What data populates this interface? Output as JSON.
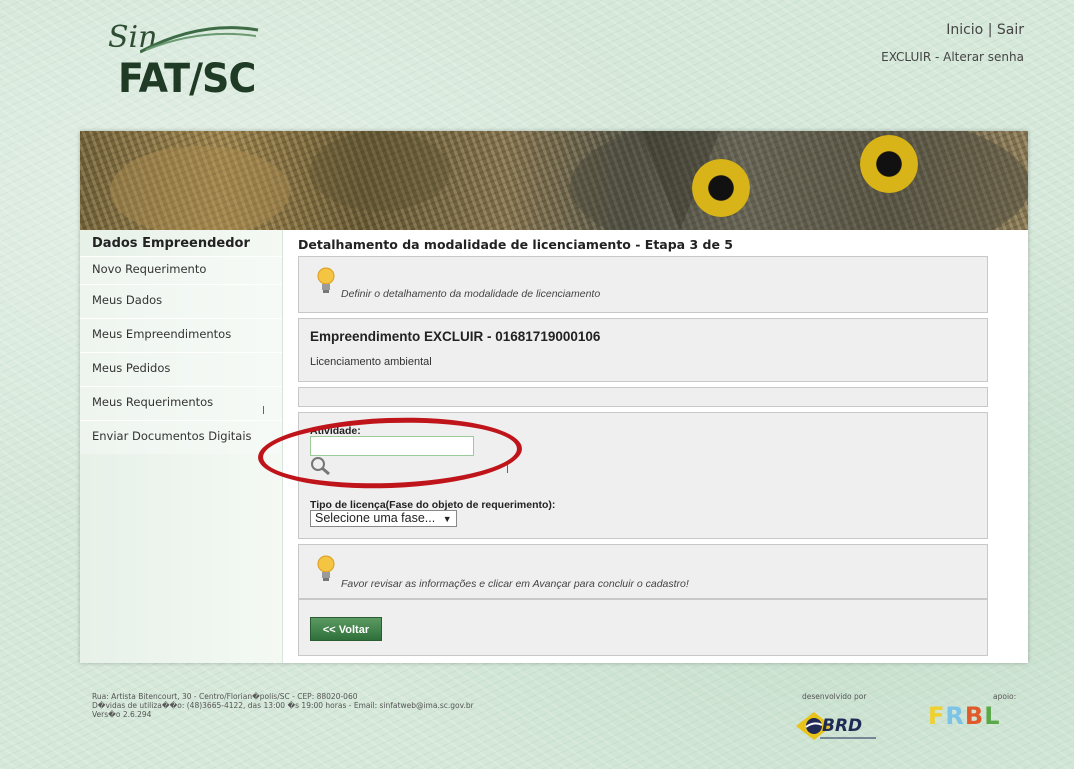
{
  "header": {
    "logo_script": "Sin",
    "logo_main": "FAT/SC",
    "link_inicio": "Inicio",
    "link_sep": "|",
    "link_sair": "Sair",
    "user_line": "EXCLUIR - Alterar senha"
  },
  "sidebar": {
    "title": "Dados Empreendedor",
    "items": [
      {
        "label": "Novo Requerimento"
      },
      {
        "label": "Meus Dados"
      },
      {
        "label": "Meus Empreendimentos"
      },
      {
        "label": "Meus Pedidos"
      },
      {
        "label": "Meus Requerimentos"
      },
      {
        "label": "Enviar Documentos Digitais"
      }
    ]
  },
  "main": {
    "heading": "Detalhamento da modalidade de licenciamento - Etapa 3 de 5",
    "tip1": "Definir o detalhamento da modalidade de licenciamento",
    "empreendimento_title": "Empreendimento EXCLUIR - 01681719000106",
    "empreendimento_sub": "Licenciamento ambiental",
    "atividade_label": "Atividade:",
    "atividade_value": "",
    "tipo_label": "Tipo de licença(Fase do objeto de requerimento):",
    "tipo_selected": "Selecione uma fase...",
    "tip2": "Favor revisar as informações e clicar em Avançar para concluir o cadastro!",
    "voltar_label": "<< Voltar"
  },
  "footer": {
    "line1": "Rua: Artista Bitencourt, 30 - Centro/Florian�polis/SC - CEP: 88020-060",
    "line2": "D�vidas de utiliza��o: (48)3665-4122, das 13:00 �s 19:00 horas - Email: sinfatweb@ima.sc.gov.br",
    "line3": "Vers�o 2.6.294",
    "dev_label": "desenvolvido por",
    "apoio_label": "apoio:",
    "brd_text": "BRD"
  },
  "colors": {
    "accent_green": "#2f6f3a",
    "highlight_red": "#c0141b"
  },
  "icons": [
    "lightbulb-icon",
    "magnifier-icon",
    "dropdown-arrow-icon"
  ]
}
